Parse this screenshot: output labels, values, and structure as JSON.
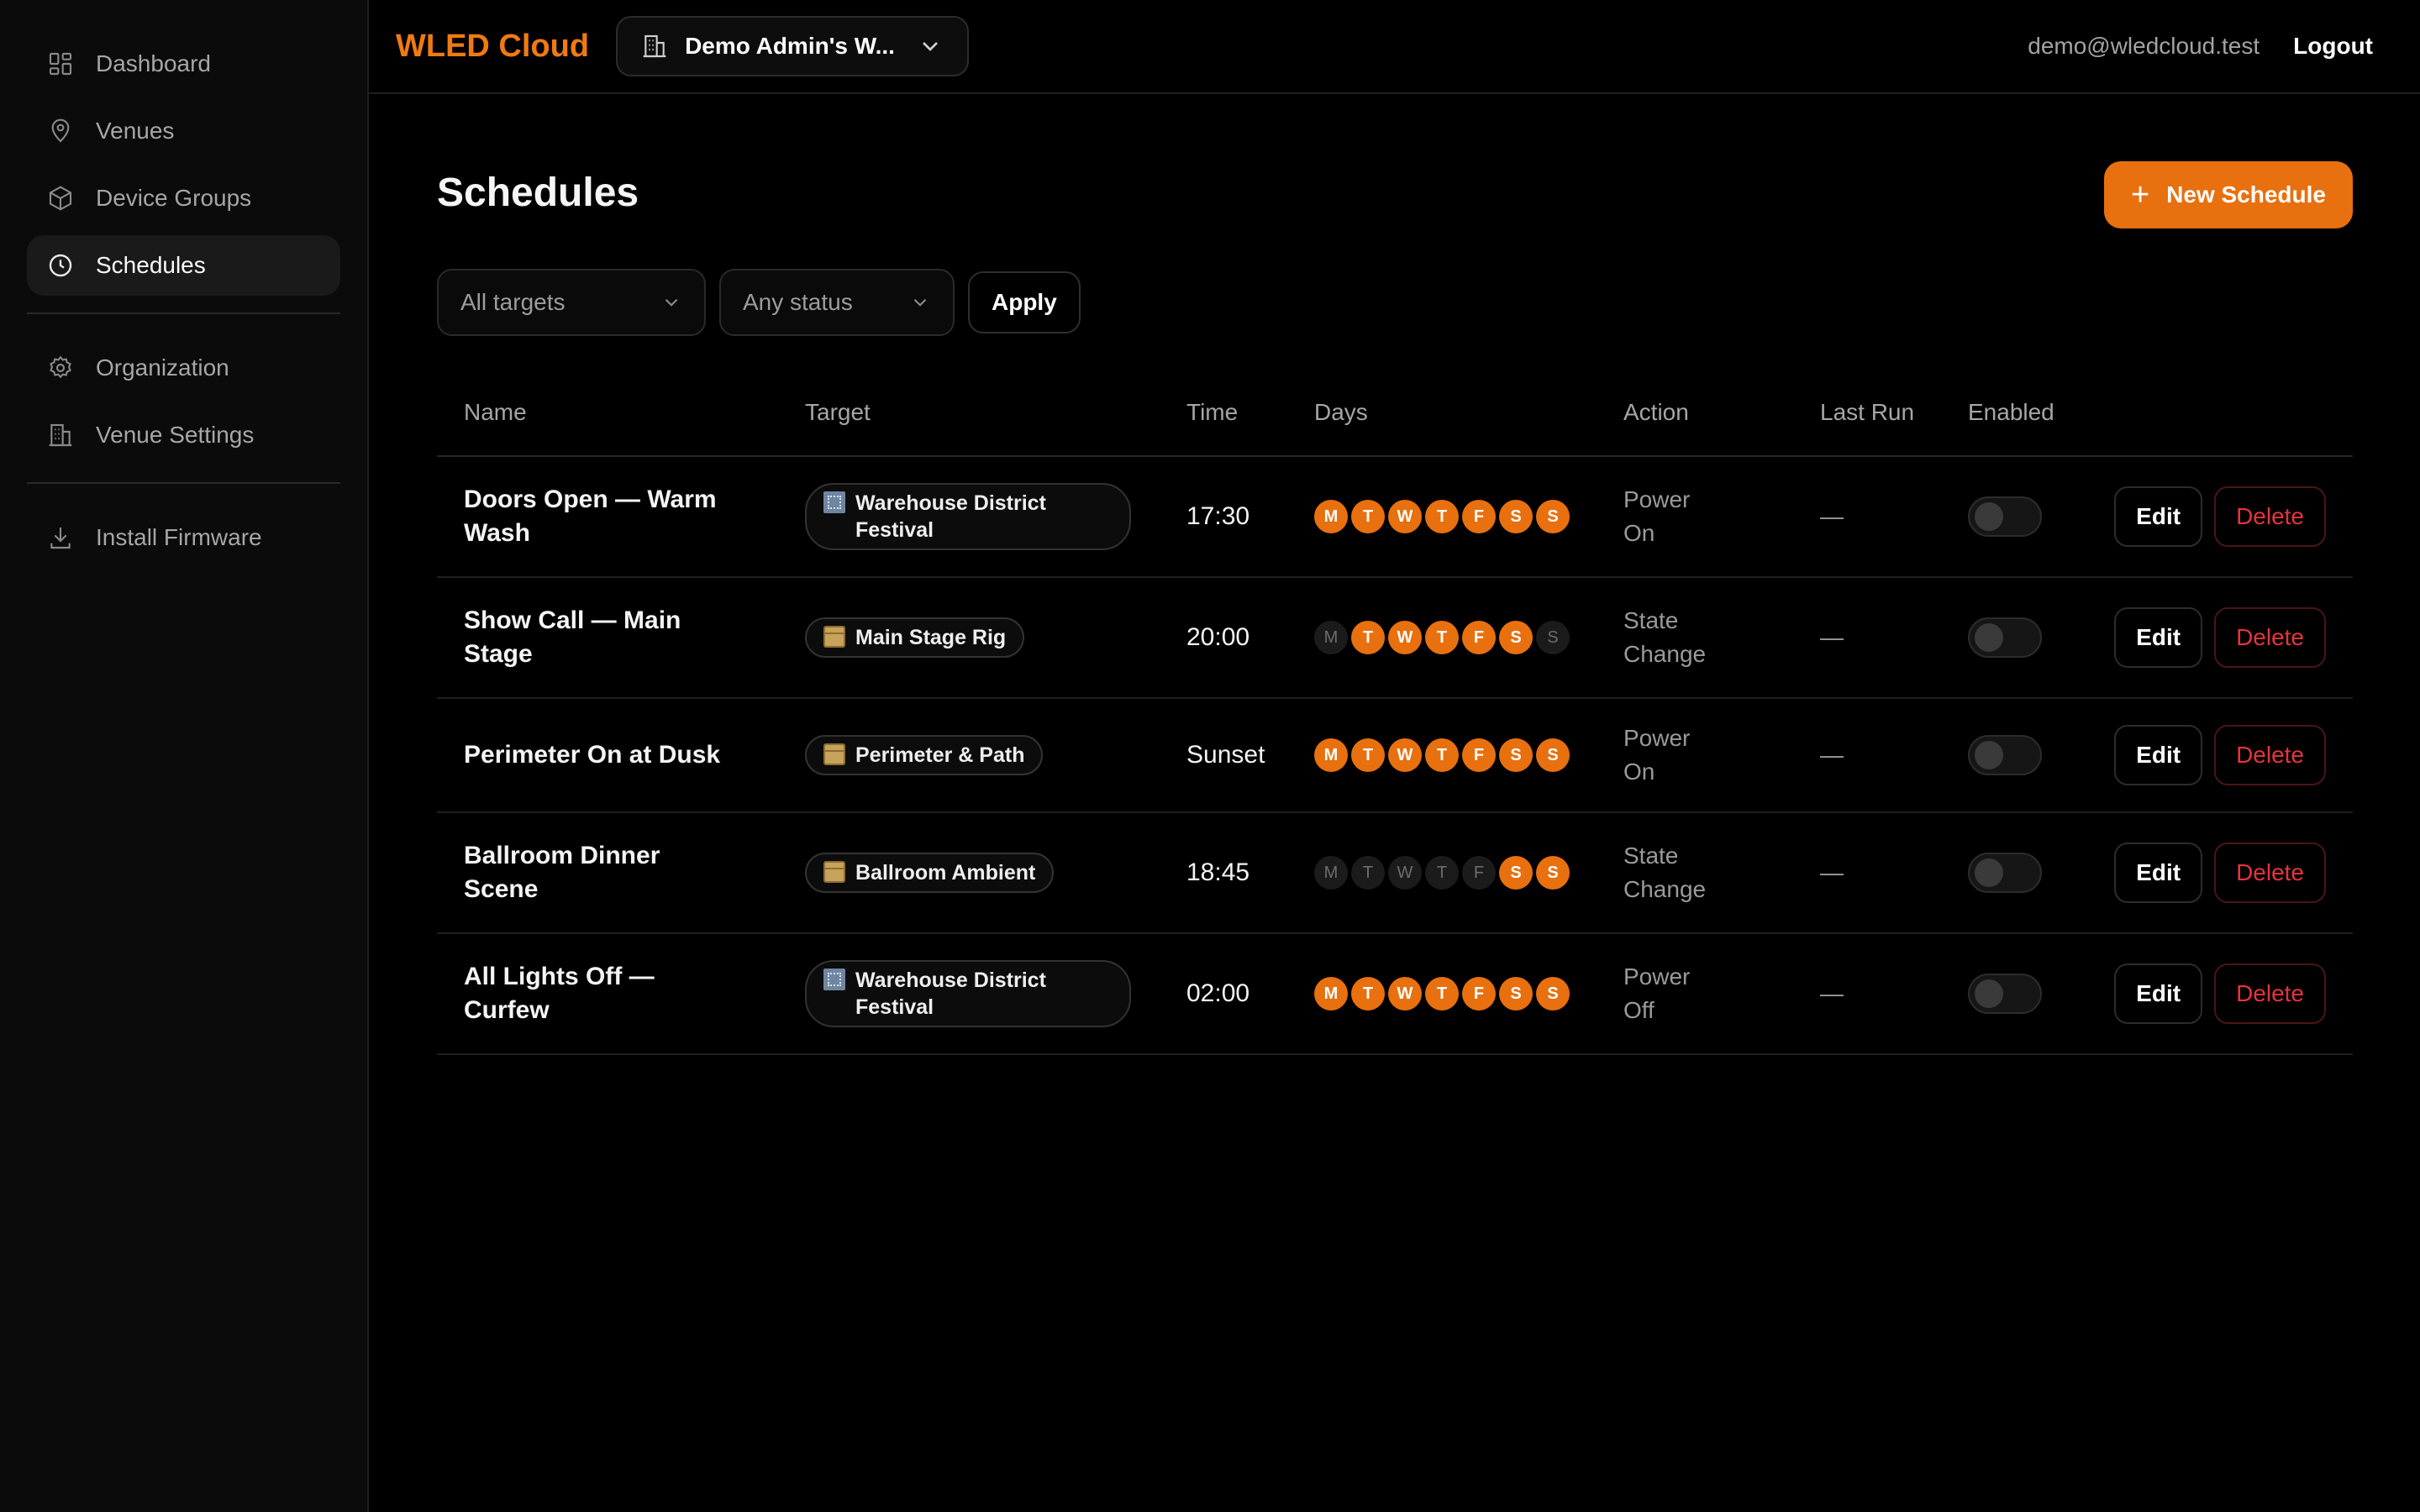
{
  "sidebar": {
    "items": [
      {
        "label": "Dashboard",
        "icon": "dashboard-icon"
      },
      {
        "label": "Venues",
        "icon": "map-pin-icon"
      },
      {
        "label": "Device Groups",
        "icon": "box-icon"
      },
      {
        "label": "Schedules",
        "icon": "clock-icon",
        "active": true
      },
      {
        "label": "Organization",
        "icon": "gear-icon"
      },
      {
        "label": "Venue Settings",
        "icon": "building-icon"
      },
      {
        "label": "Install Firmware",
        "icon": "download-icon"
      }
    ]
  },
  "topbar": {
    "brand": "WLED Cloud",
    "org_switcher": "Demo Admin's W...",
    "email": "demo@wledcloud.test",
    "logout": "Logout"
  },
  "page": {
    "title": "Schedules",
    "new_button": "New Schedule"
  },
  "filters": {
    "targets": "All targets",
    "status": "Any status",
    "apply": "Apply"
  },
  "table": {
    "headers": {
      "name": "Name",
      "target": "Target",
      "time": "Time",
      "days": "Days",
      "action": "Action",
      "last_run": "Last Run",
      "enabled": "Enabled"
    },
    "day_letters": [
      "M",
      "T",
      "W",
      "T",
      "F",
      "S",
      "S"
    ],
    "rows": [
      {
        "name": "Doors Open — Warm Wash",
        "target": "Warehouse District Festival",
        "target_icon": "building-icon",
        "time": "17:30",
        "days": [
          1,
          1,
          1,
          1,
          1,
          1,
          1
        ],
        "action": "Power On",
        "last_run": "—",
        "enabled": false,
        "edit": "Edit",
        "delete": "Delete"
      },
      {
        "name": "Show Call — Main Stage",
        "target": "Main Stage Rig",
        "target_icon": "package-icon",
        "time": "20:00",
        "days": [
          0,
          1,
          1,
          1,
          1,
          1,
          0
        ],
        "action": "State Change",
        "last_run": "—",
        "enabled": false,
        "edit": "Edit",
        "delete": "Delete"
      },
      {
        "name": "Perimeter On at Dusk",
        "target": "Perimeter & Path",
        "target_icon": "package-icon",
        "time": "Sunset",
        "days": [
          1,
          1,
          1,
          1,
          1,
          1,
          1
        ],
        "action": "Power On",
        "last_run": "—",
        "enabled": false,
        "edit": "Edit",
        "delete": "Delete"
      },
      {
        "name": "Ballroom Dinner Scene",
        "target": "Ballroom Ambient",
        "target_icon": "package-icon",
        "time": "18:45",
        "days": [
          0,
          0,
          0,
          0,
          0,
          1,
          1
        ],
        "action": "State Change",
        "last_run": "—",
        "enabled": false,
        "edit": "Edit",
        "delete": "Delete"
      },
      {
        "name": "All Lights Off — Curfew",
        "target": "Warehouse District Festival",
        "target_icon": "building-icon",
        "time": "02:00",
        "days": [
          1,
          1,
          1,
          1,
          1,
          1,
          1
        ],
        "action": "Power Off",
        "last_run": "—",
        "enabled": false,
        "edit": "Edit",
        "delete": "Delete"
      }
    ]
  },
  "colors": {
    "accent": "#e8700f",
    "danger": "#e5343c",
    "background": "#000000"
  }
}
